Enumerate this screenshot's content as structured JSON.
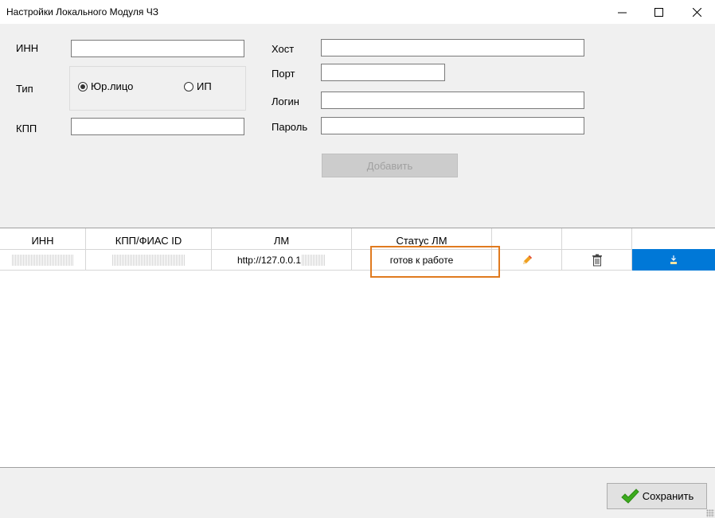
{
  "window": {
    "title": "Настройки Локального Модуля ЧЗ",
    "minimize": "–",
    "maximize": "□",
    "close": "✕"
  },
  "form": {
    "inn_label": "ИНН",
    "inn_value": "",
    "type_label": "Тип",
    "type_options": [
      "Юр.лицо",
      "ИП"
    ],
    "type_selected": "Юр.лицо",
    "kpp_label": "КПП",
    "kpp_value": "",
    "host_label": "Хост",
    "host_value": "",
    "port_label": "Порт",
    "port_value": "",
    "login_label": "Логин",
    "login_value": "",
    "password_label": "Пароль",
    "password_value": "",
    "add_button": "Добавить"
  },
  "grid": {
    "columns": [
      "ИНН",
      "КПП/ФИАС ID",
      "ЛМ",
      "Статус ЛМ",
      "",
      "",
      ""
    ],
    "rows": [
      {
        "inn": "",
        "kpp": "",
        "lm": "http://127.0.0.1",
        "status": "готов к работе",
        "edit_icon": "pencil-icon",
        "delete_icon": "trash-icon",
        "action_icon": "download-icon"
      }
    ]
  },
  "footer": {
    "save_button": "Сохранить",
    "save_icon": "checkmark-icon"
  },
  "colors": {
    "accent": "#0078d7",
    "highlight": "#e07a1f",
    "check_green": "#3cab1e"
  }
}
